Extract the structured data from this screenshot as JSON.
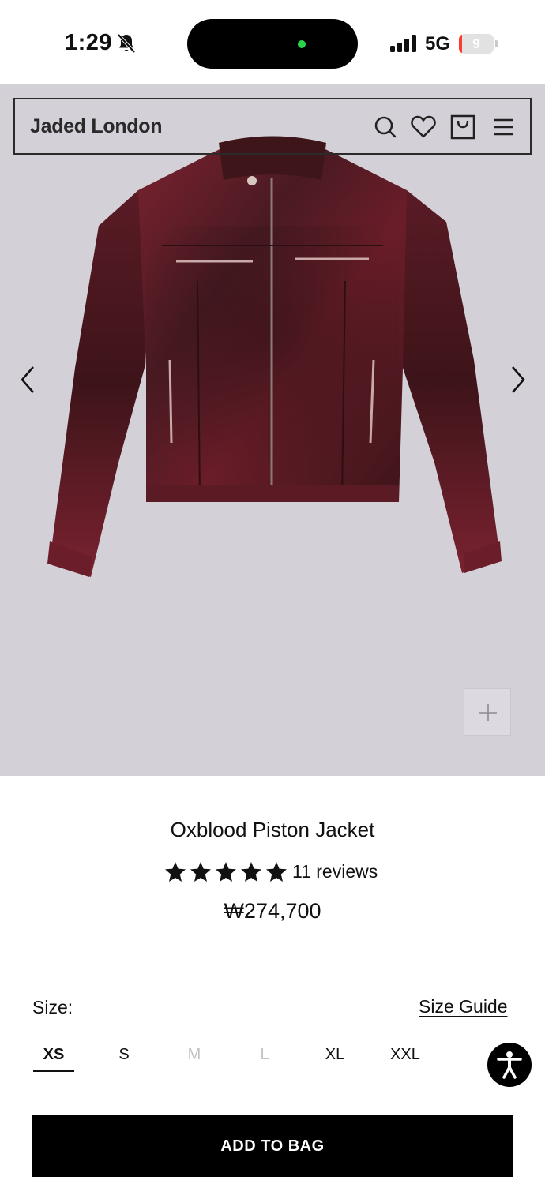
{
  "status_bar": {
    "time": "1:29",
    "network": "5G",
    "battery_level": "9",
    "battery_fraction": 0.09,
    "icons": [
      "bell-slash-icon",
      "signal-icon"
    ]
  },
  "header": {
    "logo": "Jaded London",
    "icons": [
      "search-icon",
      "heart-icon",
      "bag-icon",
      "menu-icon"
    ]
  },
  "gallery": {
    "image": "oxblood-leather-jacket",
    "icons": [
      "chevron-left-icon",
      "chevron-right-icon",
      "plus-icon"
    ]
  },
  "product": {
    "title": "Oxblood Piston Jacket",
    "rating": 5,
    "reviews": "11 reviews",
    "price": "₩274,700"
  },
  "size_section": {
    "label": "Size:",
    "guide": "Size Guide",
    "sizes": [
      {
        "label": "XS",
        "state": "selected"
      },
      {
        "label": "S",
        "state": "available"
      },
      {
        "label": "M",
        "state": "unavailable"
      },
      {
        "label": "L",
        "state": "unavailable"
      },
      {
        "label": "XL",
        "state": "available"
      },
      {
        "label": "XXL",
        "state": "available"
      }
    ]
  },
  "cta": {
    "add_to_bag": "ADD TO BAG"
  },
  "colors": {
    "hero_background": "#d3d0d8",
    "jacket": "#6e1f2b",
    "button": "#000000"
  }
}
